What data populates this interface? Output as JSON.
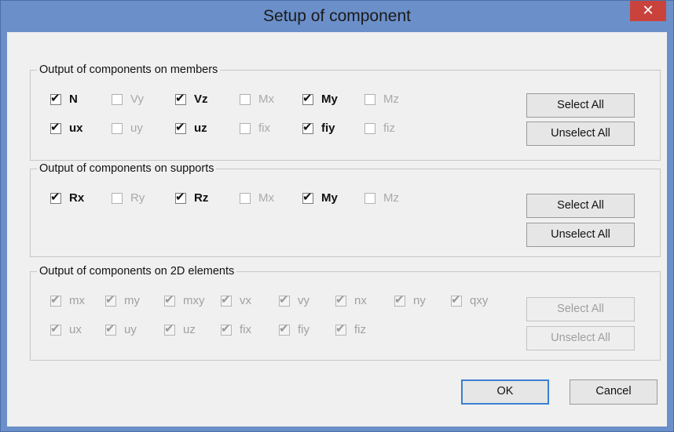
{
  "window": {
    "title": "Setup of component",
    "close_glyph": "✕"
  },
  "members": {
    "legend": "Output of components on members",
    "checkboxes": [
      {
        "label": "N",
        "checked": true
      },
      {
        "label": "Vy",
        "checked": false
      },
      {
        "label": "Vz",
        "checked": true
      },
      {
        "label": "Mx",
        "checked": false
      },
      {
        "label": "My",
        "checked": true
      },
      {
        "label": "Mz",
        "checked": false
      },
      {
        "label": "ux",
        "checked": true
      },
      {
        "label": "uy",
        "checked": false
      },
      {
        "label": "uz",
        "checked": true
      },
      {
        "label": "fix",
        "checked": false
      },
      {
        "label": "fiy",
        "checked": true
      },
      {
        "label": "fiz",
        "checked": false
      }
    ],
    "select_all": "Select All",
    "unselect_all": "Unselect All"
  },
  "supports": {
    "legend": "Output of components on supports",
    "checkboxes": [
      {
        "label": "Rx",
        "checked": true
      },
      {
        "label": "Ry",
        "checked": false
      },
      {
        "label": "Rz",
        "checked": true
      },
      {
        "label": "Mx",
        "checked": false
      },
      {
        "label": "My",
        "checked": true
      },
      {
        "label": "Mz",
        "checked": false
      }
    ],
    "select_all": "Select All",
    "unselect_all": "Unselect All"
  },
  "elements2d": {
    "legend": "Output of components on 2D elements",
    "checkboxes": [
      {
        "label": "mx",
        "checked": true
      },
      {
        "label": "my",
        "checked": true
      },
      {
        "label": "mxy",
        "checked": true
      },
      {
        "label": "vx",
        "checked": true
      },
      {
        "label": "vy",
        "checked": true
      },
      {
        "label": "nx",
        "checked": true
      },
      {
        "label": "ny",
        "checked": true
      },
      {
        "label": "qxy",
        "checked": true
      },
      {
        "label": "ux",
        "checked": true
      },
      {
        "label": "uy",
        "checked": true
      },
      {
        "label": "uz",
        "checked": true
      },
      {
        "label": "fix",
        "checked": true
      },
      {
        "label": "fiy",
        "checked": true
      },
      {
        "label": "fiz",
        "checked": true
      }
    ],
    "select_all": "Select All",
    "unselect_all": "Unselect All"
  },
  "footer": {
    "ok": "OK",
    "cancel": "Cancel"
  },
  "colors": {
    "titlebar": "#6b8fc9",
    "close": "#c9433c",
    "dialog_bg": "#f0f0f0"
  },
  "icons": {
    "close": "close-icon",
    "check": "check-icon"
  }
}
